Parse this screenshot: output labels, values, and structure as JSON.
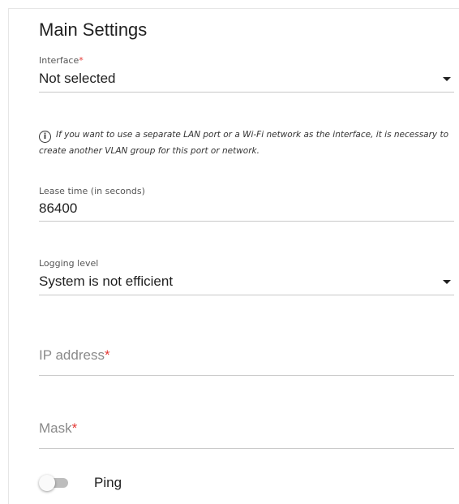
{
  "section": {
    "title": "Main Settings"
  },
  "interface": {
    "label": "Interface",
    "required_mark": "*",
    "value": "Not selected",
    "note": "If you want to use a separate LAN port or a Wi-Fi network as the interface, it is necessary to create another VLAN group for this port or network."
  },
  "lease_time": {
    "label": "Lease time (in seconds)",
    "value": "86400"
  },
  "logging_level": {
    "label": "Logging level",
    "value": "System is not efficient"
  },
  "ip_address": {
    "placeholder": "IP address",
    "required_mark": "*"
  },
  "mask": {
    "placeholder": "Mask",
    "required_mark": "*"
  },
  "ping": {
    "label": "Ping",
    "enabled": false
  },
  "colors": {
    "required": "#e53935",
    "toggle_off_track": "#bdbdbd"
  }
}
